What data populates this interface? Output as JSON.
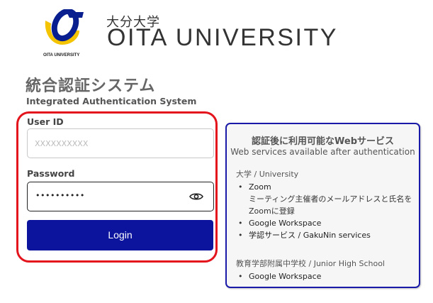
{
  "header": {
    "logo_small_text": "OITA UNIVERSITY",
    "university_jp": "大分大学",
    "university_en": "OITA UNIVERSITY"
  },
  "system": {
    "title": "統合認証システム",
    "subtitle": "Integrated Authentication System"
  },
  "login": {
    "user_label": "User ID",
    "user_placeholder": "XXXXXXXXXX",
    "password_label": "Password",
    "password_value": "••••••••••",
    "login_button": "Login"
  },
  "services": {
    "heading_jp": "認証後に利用可能なWebサービス",
    "heading_en": "Web services available after authentication",
    "sections": [
      {
        "title": "大学 / University",
        "items": [
          {
            "label": "Zoom",
            "note": "ミーティング主催者のメールアドレスと氏名をZoomに登録"
          },
          {
            "label": "Google Workspace"
          },
          {
            "label": "学認サービス / GakuNin services"
          }
        ]
      },
      {
        "title": "教育学部附属中学校 / Junior High School",
        "items": [
          {
            "label": "Google Workspace"
          }
        ]
      }
    ]
  },
  "colors": {
    "login_button_bg": "#0c149d",
    "login_frame_border": "#e3141c",
    "services_border": "#1a1aa8",
    "logo_blue": "#0a1f8f",
    "logo_yellow": "#f4c400"
  },
  "icons": {
    "logo": "oita-university-logo-icon",
    "password_toggle": "eye-icon"
  }
}
